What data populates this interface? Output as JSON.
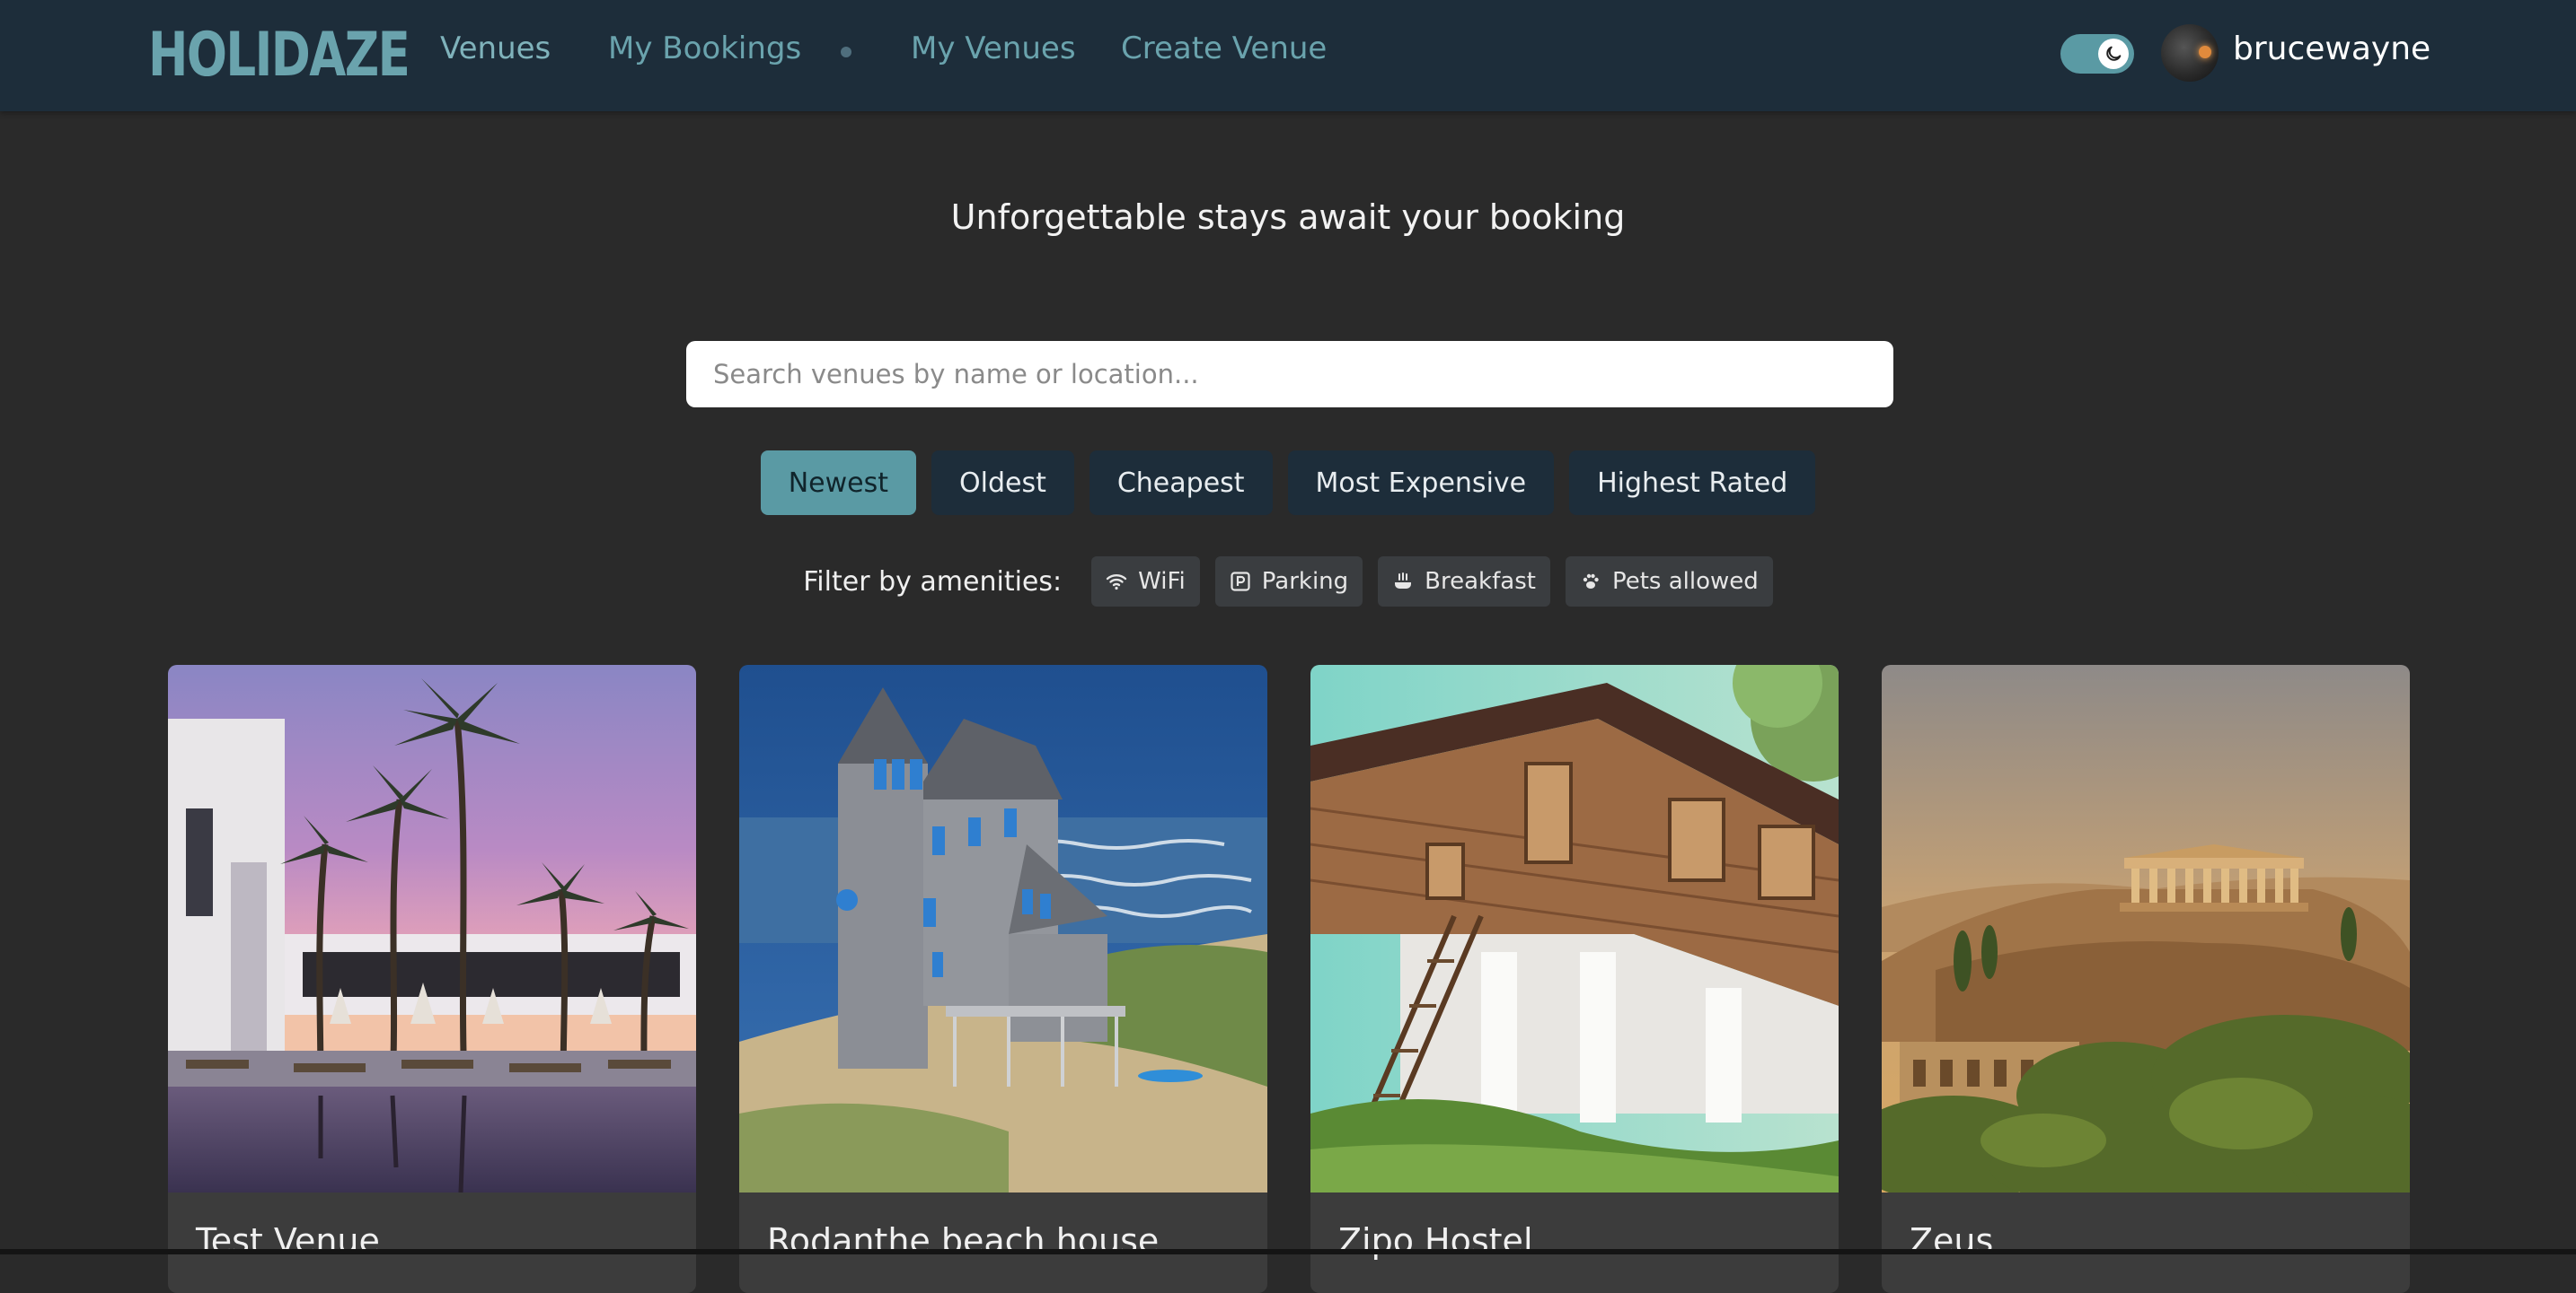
{
  "brand": {
    "logo_text": "HOLIDAZE"
  },
  "nav": {
    "links": [
      {
        "label": "Venues",
        "active": true
      },
      {
        "label": "My Bookings"
      },
      {
        "label": "My Venues"
      },
      {
        "label": "Create Venue"
      }
    ],
    "theme_toggle_icon": "moon-icon",
    "username": "brucewayne"
  },
  "hero": {
    "tagline": "Unforgettable stays await your booking",
    "search_placeholder": "Search venues by name or location..."
  },
  "sort": {
    "options": [
      "Newest",
      "Oldest",
      "Cheapest",
      "Most Expensive",
      "Highest Rated"
    ],
    "selected": "Newest"
  },
  "filters": {
    "label": "Filter by amenities:",
    "amenities": [
      {
        "label": "WiFi",
        "icon": "wifi-icon"
      },
      {
        "label": "Parking",
        "icon": "parking-icon"
      },
      {
        "label": "Breakfast",
        "icon": "breakfast-icon"
      },
      {
        "label": "Pets allowed",
        "icon": "paw-icon"
      }
    ]
  },
  "venues": [
    {
      "name": "Test Venue",
      "image": "resort-pool-palms-photo"
    },
    {
      "name": "Rodanthe beach house",
      "image": "beach-house-photo"
    },
    {
      "name": "Zipo Hostel",
      "image": "wooden-stilt-house-photo"
    },
    {
      "name": "Zeus",
      "image": "acropolis-photo"
    }
  ],
  "colors": {
    "navbar_bg": "#1d2d3a",
    "page_bg": "#2a2a2a",
    "accent": "#5a9aa4",
    "card_bg": "#3c3c3c"
  }
}
